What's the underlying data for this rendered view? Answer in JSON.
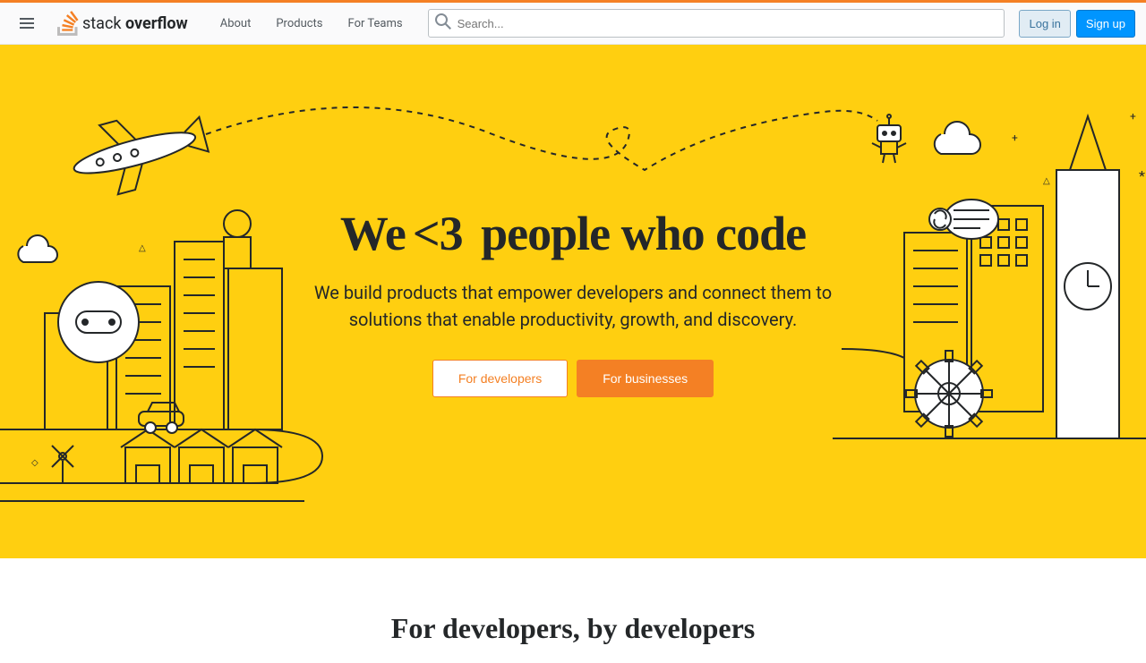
{
  "header": {
    "logo_light": "stack",
    "logo_bold": "overflow",
    "nav": {
      "about": "About",
      "products": "Products",
      "teams": "For Teams"
    },
    "search": {
      "placeholder": "Search..."
    },
    "auth": {
      "login": "Log in",
      "signup": "Sign up"
    }
  },
  "hero": {
    "title_pre": "We",
    "title_heart": "<3",
    "title_post": "people who code",
    "subtitle": "We build products that empower developers and connect them to solutions that enable productivity, growth, and discovery.",
    "cta_developers": "For developers",
    "cta_businesses": "For businesses"
  },
  "section2": {
    "title": "For developers, by developers"
  },
  "colors": {
    "accent": "#f48024",
    "hero_bg": "#ffcf10",
    "primary_blue": "#0095ff"
  }
}
